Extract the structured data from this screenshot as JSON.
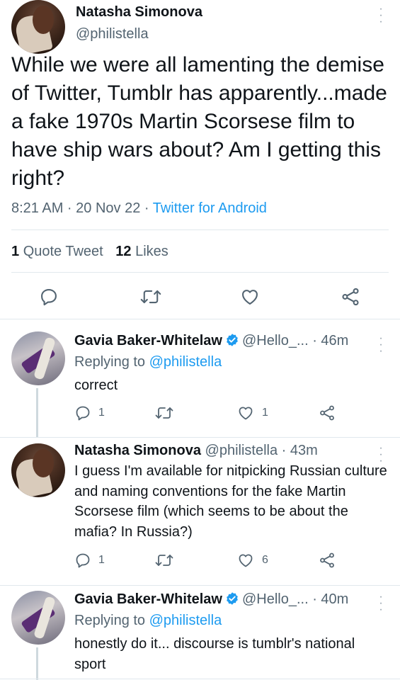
{
  "main_tweet": {
    "author_name": "Natasha Simonova",
    "handle": "@philistella",
    "text": "While we were all lamenting the demise of Twitter, Tumblr has apparently...made a fake 1970s Martin Scorsese film to have ship wars about? Am I getting this right?",
    "time_date": "8:21 AM · 20 Nov 22 · ",
    "source": "Twitter for Android",
    "quote_count": "1",
    "quote_label": "Quote Tweet",
    "like_count": "12",
    "like_label": "Likes"
  },
  "replies": [
    {
      "author_name": "Gavia Baker-Whitelaw",
      "handle_time": "@Hello_... · 46m",
      "replying_prefix": "Replying to ",
      "replying_to": "@philistella",
      "text": "correct",
      "reply_count": "1",
      "retweet_count": "",
      "like_count": "1"
    },
    {
      "author_name": "Natasha Simonova",
      "handle_time": "@philistella · 43m",
      "text": "I guess I'm available for nitpicking Russian culture and naming conventions for the fake Martin Scorsese film (which seems to be about the mafia? In Russia?)",
      "reply_count": "1",
      "retweet_count": "",
      "like_count": "6"
    },
    {
      "author_name": "Gavia Baker-Whitelaw",
      "handle_time": "@Hello_... · 40m",
      "replying_prefix": "Replying to ",
      "replying_to": "@philistella",
      "text": "honestly do it... discourse is tumblr's national sport"
    }
  ],
  "colors": {
    "accent": "#1d9bf0",
    "secondary_text": "#536471",
    "verified": "#1d9bf0"
  },
  "icons": [
    "more-icon",
    "reply-icon",
    "retweet-icon",
    "like-icon",
    "share-icon",
    "verified-badge-icon"
  ]
}
